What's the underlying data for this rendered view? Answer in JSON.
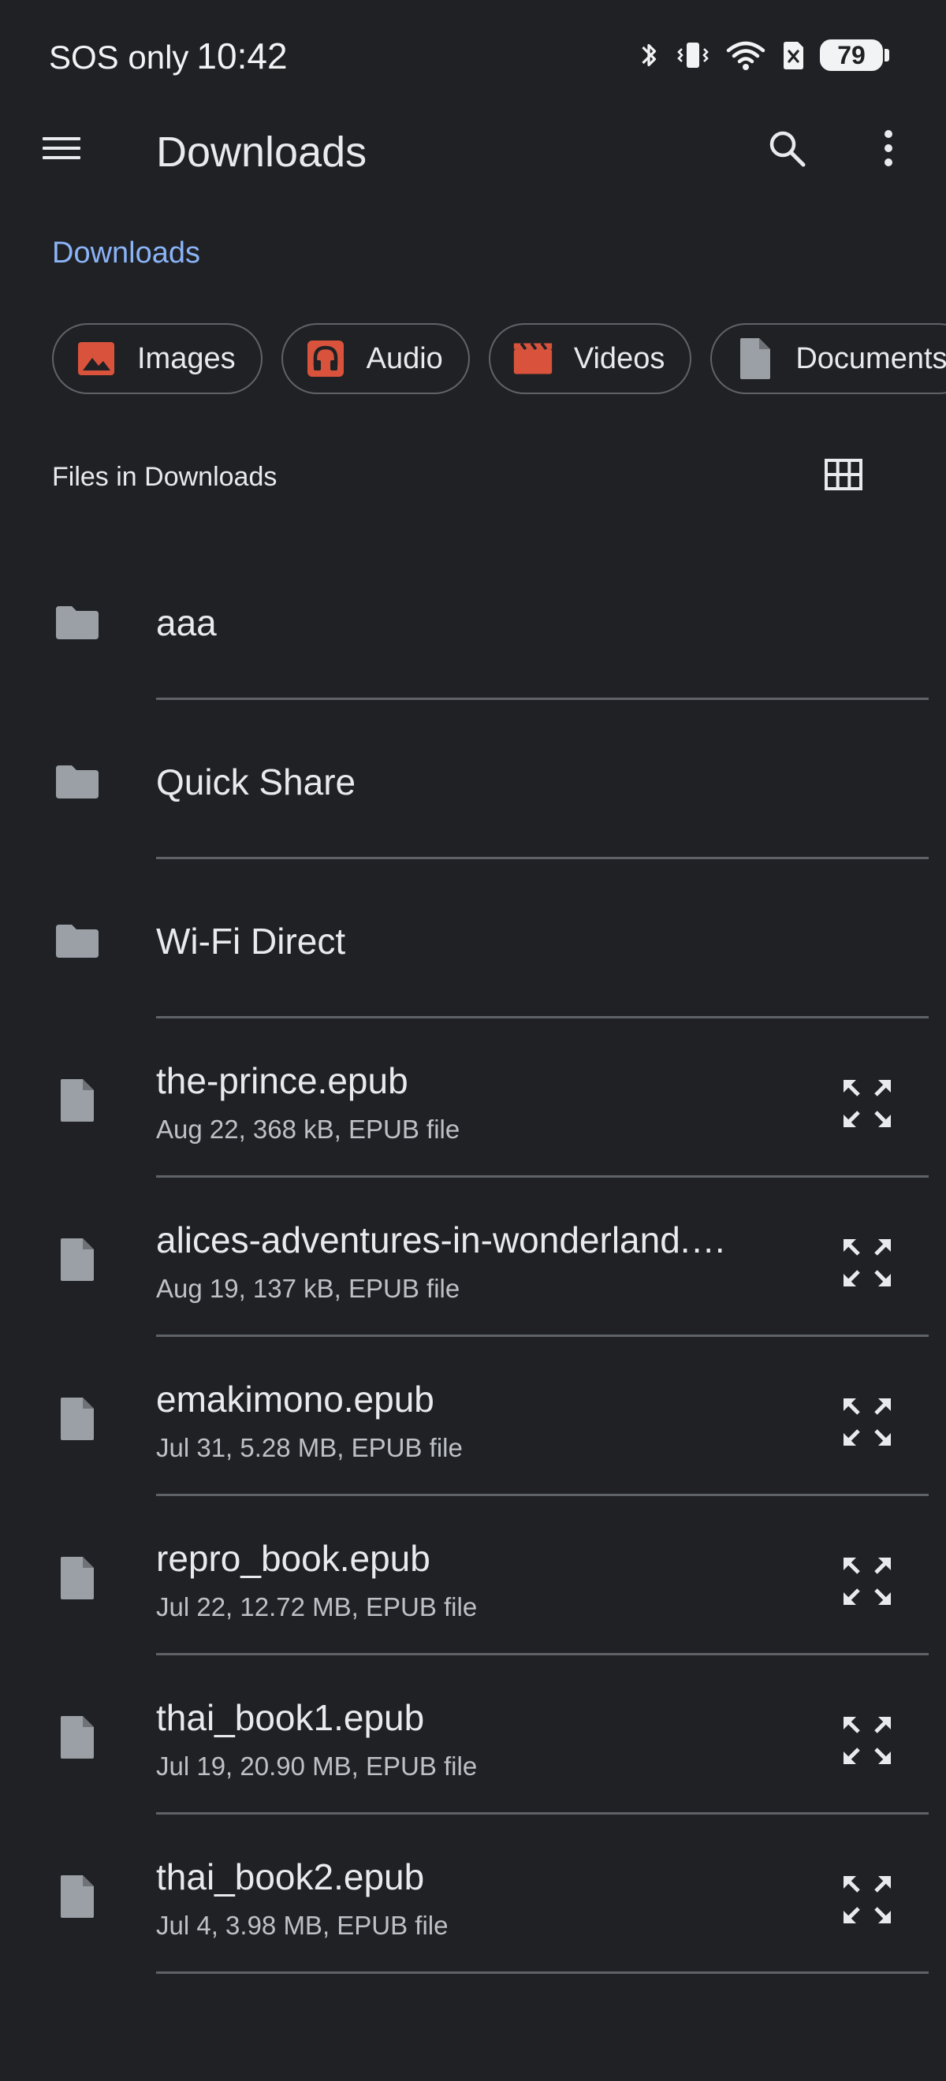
{
  "status_bar": {
    "carrier": "SOS only",
    "time": "10:42",
    "battery": "79"
  },
  "app_bar": {
    "title": "Downloads",
    "menu_icon": "menu-icon",
    "search_icon": "search-icon",
    "more_icon": "more-vert-icon"
  },
  "breadcrumb": "Downloads",
  "chips": [
    {
      "label": "Images",
      "icon": "image-icon",
      "color": "#d9533c"
    },
    {
      "label": "Audio",
      "icon": "headphones-icon",
      "color": "#d9533c"
    },
    {
      "label": "Videos",
      "icon": "movie-icon",
      "color": "#d9533c"
    },
    {
      "label": "Documents",
      "icon": "document-icon",
      "color": "#9aa0a6"
    }
  ],
  "section": {
    "title": "Files in Downloads",
    "view_toggle_icon": "grid-view-icon"
  },
  "items": [
    {
      "type": "folder",
      "name": "aaa"
    },
    {
      "type": "folder",
      "name": "Quick Share"
    },
    {
      "type": "folder",
      "name": "Wi-Fi Direct"
    },
    {
      "type": "file",
      "name": "the-prince.epub",
      "meta": "Aug 22, 368 kB, EPUB file"
    },
    {
      "type": "file",
      "name": "alices-adventures-in-wonderland.epub",
      "meta": "Aug 19, 137 kB, EPUB file"
    },
    {
      "type": "file",
      "name": "emakimono.epub",
      "meta": "Jul 31, 5.28 MB, EPUB file"
    },
    {
      "type": "file",
      "name": "repro_book.epub",
      "meta": "Jul 22, 12.72 MB, EPUB file"
    },
    {
      "type": "file",
      "name": "thai_book1.epub",
      "meta": "Jul 19, 20.90 MB, EPUB file"
    },
    {
      "type": "file",
      "name": "thai_book2.epub",
      "meta": "Jul 4, 3.98 MB, EPUB file"
    }
  ],
  "colors": {
    "background": "#202124",
    "accent": "#8ab4f8",
    "chip_icon_media": "#d9533c",
    "icon_gray": "#9aa0a6"
  }
}
